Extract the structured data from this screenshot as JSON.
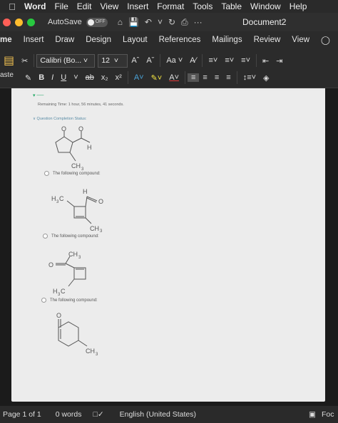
{
  "menubar": {
    "app": "Word",
    "items": [
      "File",
      "Edit",
      "View",
      "Insert",
      "Format",
      "Tools",
      "Table",
      "Window",
      "Help"
    ]
  },
  "titlebar": {
    "autosave_label": "AutoSave",
    "autosave_state": "OFF",
    "document_title": "Document2"
  },
  "ribbon_tabs": [
    "me",
    "Insert",
    "Draw",
    "Design",
    "Layout",
    "References",
    "Mailings",
    "Review",
    "View"
  ],
  "ribbon": {
    "font_name": "Calibri (Bo...",
    "font_size": "12",
    "paste_label": "aste"
  },
  "document": {
    "remaining_time": "Remaining Time: 1 hour, 56 minutes, 41 seconds.",
    "completion_status": "∨ Question Completion Status:",
    "options": [
      "The following compound:",
      "The following compound:",
      "The following compound:"
    ],
    "labels": {
      "h": "H",
      "ch3": "CH",
      "h3c": "H",
      "o": "O",
      "three": "3",
      "c": "C"
    }
  },
  "statusbar": {
    "page": "Page 1 of 1",
    "words": "0 words",
    "language": "English (United States)",
    "focus": "Foc"
  },
  "colors": {
    "close": "#ff5f57",
    "minimize": "#febc2e",
    "maximize": "#28c840",
    "accent": "#4aa3d8"
  }
}
